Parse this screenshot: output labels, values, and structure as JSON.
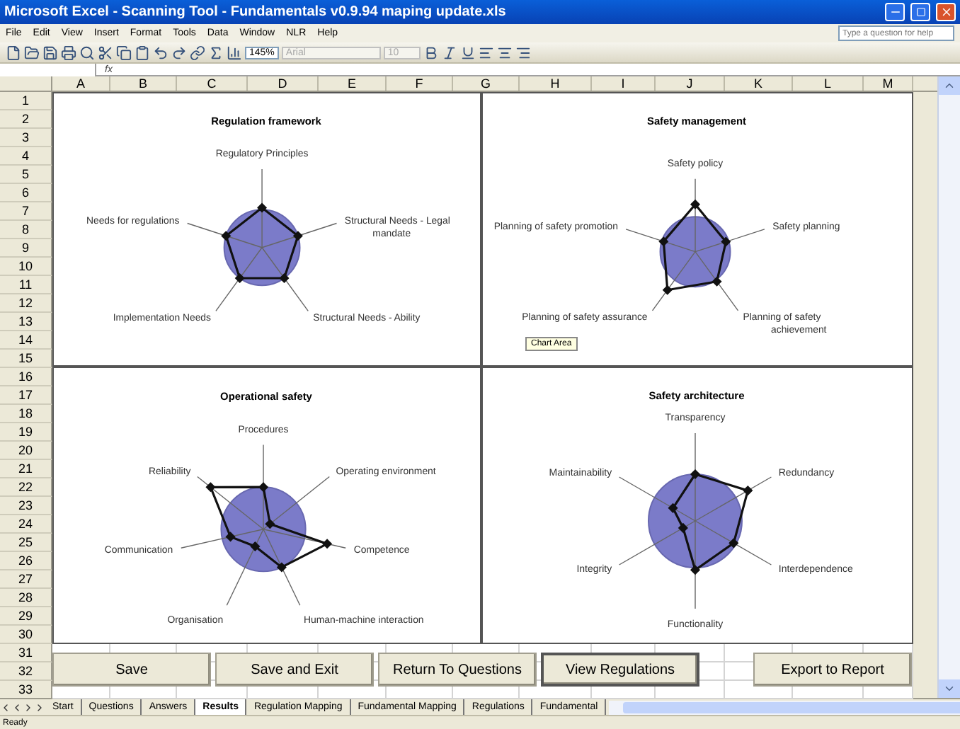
{
  "window": {
    "title": "Microsoft Excel - Scanning Tool - Fundamentals v0.9.94 maping update.xls"
  },
  "menu": [
    "File",
    "Edit",
    "View",
    "Insert",
    "Format",
    "Tools",
    "Data",
    "Window",
    "NLR",
    "Help"
  ],
  "help_box": {
    "placeholder": "Type a question for help"
  },
  "toolbar": {
    "zoom": "145%",
    "font": "Arial",
    "font_size": "10"
  },
  "formula_bar": {
    "fx": "fx"
  },
  "columns": [
    "A",
    "B",
    "C",
    "D",
    "E",
    "F",
    "G",
    "H",
    "I",
    "J",
    "K",
    "L",
    "M"
  ],
  "rows": [
    "1",
    "2",
    "3",
    "4",
    "5",
    "6",
    "7",
    "8",
    "9",
    "10",
    "11",
    "12",
    "13",
    "14",
    "15",
    "16",
    "17",
    "18",
    "19",
    "20",
    "21",
    "22",
    "23",
    "24",
    "25",
    "26",
    "27",
    "28",
    "29",
    "30",
    "31",
    "32",
    "33"
  ],
  "charts": [
    {
      "title": "Regulation framework",
      "axes": [
        [
          "Regulatory Principles"
        ],
        [
          "Needs for regulations"
        ],
        [
          "Structural Needs - Legal",
          "mandate"
        ],
        [
          "Implementation Needs"
        ],
        [
          "Structural Needs - Ability"
        ]
      ]
    },
    {
      "title": "Safety management",
      "axes": [
        [
          "Safety policy"
        ],
        [
          "Planning of safety promotion"
        ],
        [
          "Safety planning"
        ],
        [
          "Planning of safety assurance"
        ],
        [
          "Planning of safety",
          "achievement"
        ]
      ],
      "tooltip": "Chart Area"
    },
    {
      "title": "Operational safety",
      "axes": [
        [
          "Procedures"
        ],
        [
          "Reliability"
        ],
        [
          "Operating environment"
        ],
        [
          "Communication"
        ],
        [
          "Competence"
        ],
        [
          "Organisation"
        ],
        [
          "Human-machine interaction"
        ]
      ]
    },
    {
      "title": "Safety architecture",
      "axes": [
        [
          "Transparency"
        ],
        [
          "Maintainability"
        ],
        [
          "Redundancy"
        ],
        [
          "Integrity"
        ],
        [
          "Interdependence"
        ],
        [
          "Functionality"
        ]
      ]
    }
  ],
  "buttons": [
    {
      "label": "Save",
      "focused": false
    },
    {
      "label": "Save and Exit",
      "focused": false
    },
    {
      "label": "Return To Questions",
      "focused": false
    },
    {
      "label": "View Regulations",
      "focused": true
    },
    {
      "label": "Export to Report",
      "focused": false
    }
  ],
  "sheet_tabs": [
    {
      "label": "Start",
      "selected": false
    },
    {
      "label": "Questions",
      "selected": false
    },
    {
      "label": "Answers",
      "selected": false
    },
    {
      "label": "Results",
      "selected": true
    },
    {
      "label": "Regulation Mapping",
      "selected": false
    },
    {
      "label": "Fundamental Mapping",
      "selected": false
    },
    {
      "label": "Regulations",
      "selected": false
    },
    {
      "label": "Fundamental",
      "selected": false
    }
  ],
  "status_bar": {
    "text": "Ready"
  }
}
